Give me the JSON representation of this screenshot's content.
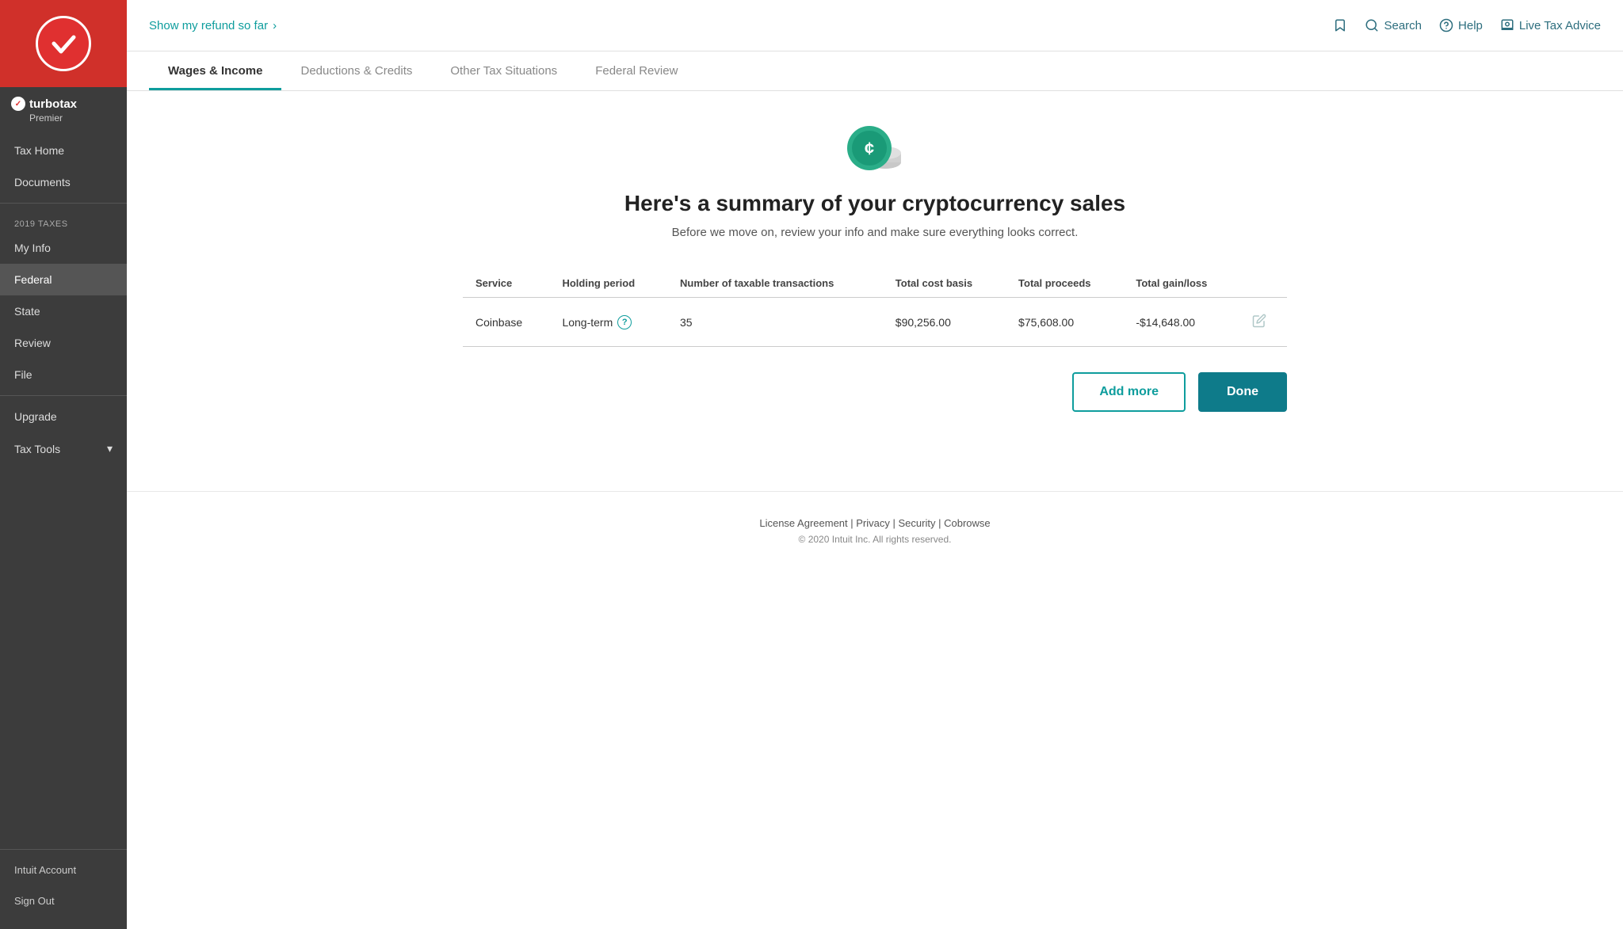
{
  "sidebar": {
    "logo_check": "✓",
    "brand_name": "turbotax",
    "brand_sub": "Premier",
    "nav_items": [
      {
        "id": "tax-home",
        "label": "Tax Home",
        "active": false
      },
      {
        "id": "documents",
        "label": "Documents",
        "active": false
      }
    ],
    "section_label": "2019 TAXES",
    "tax_items": [
      {
        "id": "my-info",
        "label": "My Info",
        "active": false
      },
      {
        "id": "federal",
        "label": "Federal",
        "active": true
      },
      {
        "id": "state",
        "label": "State",
        "active": false
      },
      {
        "id": "review",
        "label": "Review",
        "active": false
      },
      {
        "id": "file",
        "label": "File",
        "active": false
      }
    ],
    "bottom_items": [
      {
        "id": "upgrade",
        "label": "Upgrade"
      },
      {
        "id": "tax-tools",
        "label": "Tax Tools"
      }
    ],
    "account_items": [
      {
        "id": "intuit-account",
        "label": "Intuit Account"
      },
      {
        "id": "sign-out",
        "label": "Sign Out"
      }
    ]
  },
  "topbar": {
    "refund_link": "Show my refund so far",
    "search_label": "Search",
    "help_label": "Help",
    "live_advice_label": "Live Tax Advice"
  },
  "tabs": [
    {
      "id": "wages-income",
      "label": "Wages & Income",
      "active": true
    },
    {
      "id": "deductions-credits",
      "label": "Deductions & Credits",
      "active": false
    },
    {
      "id": "other-tax",
      "label": "Other Tax Situations",
      "active": false
    },
    {
      "id": "federal-review",
      "label": "Federal Review",
      "active": false
    }
  ],
  "hero": {
    "title": "Here's a summary of your cryptocurrency sales",
    "subtitle": "Before we move on, review your info and make sure everything looks correct."
  },
  "table": {
    "headers": [
      "Service",
      "Holding period",
      "Number of taxable transactions",
      "Total cost basis",
      "Total proceeds",
      "Total gain/loss",
      ""
    ],
    "rows": [
      {
        "service": "Coinbase",
        "holding_period": "Long-term",
        "transactions": "35",
        "cost_basis": "$90,256.00",
        "proceeds": "$75,608.00",
        "gain_loss": "-$14,648.00"
      }
    ]
  },
  "actions": {
    "add_more": "Add more",
    "done": "Done"
  },
  "footer": {
    "links": [
      "License Agreement",
      "Privacy",
      "Security",
      "Cobrowse"
    ],
    "copyright": "© 2020 Intuit Inc. All rights reserved."
  }
}
